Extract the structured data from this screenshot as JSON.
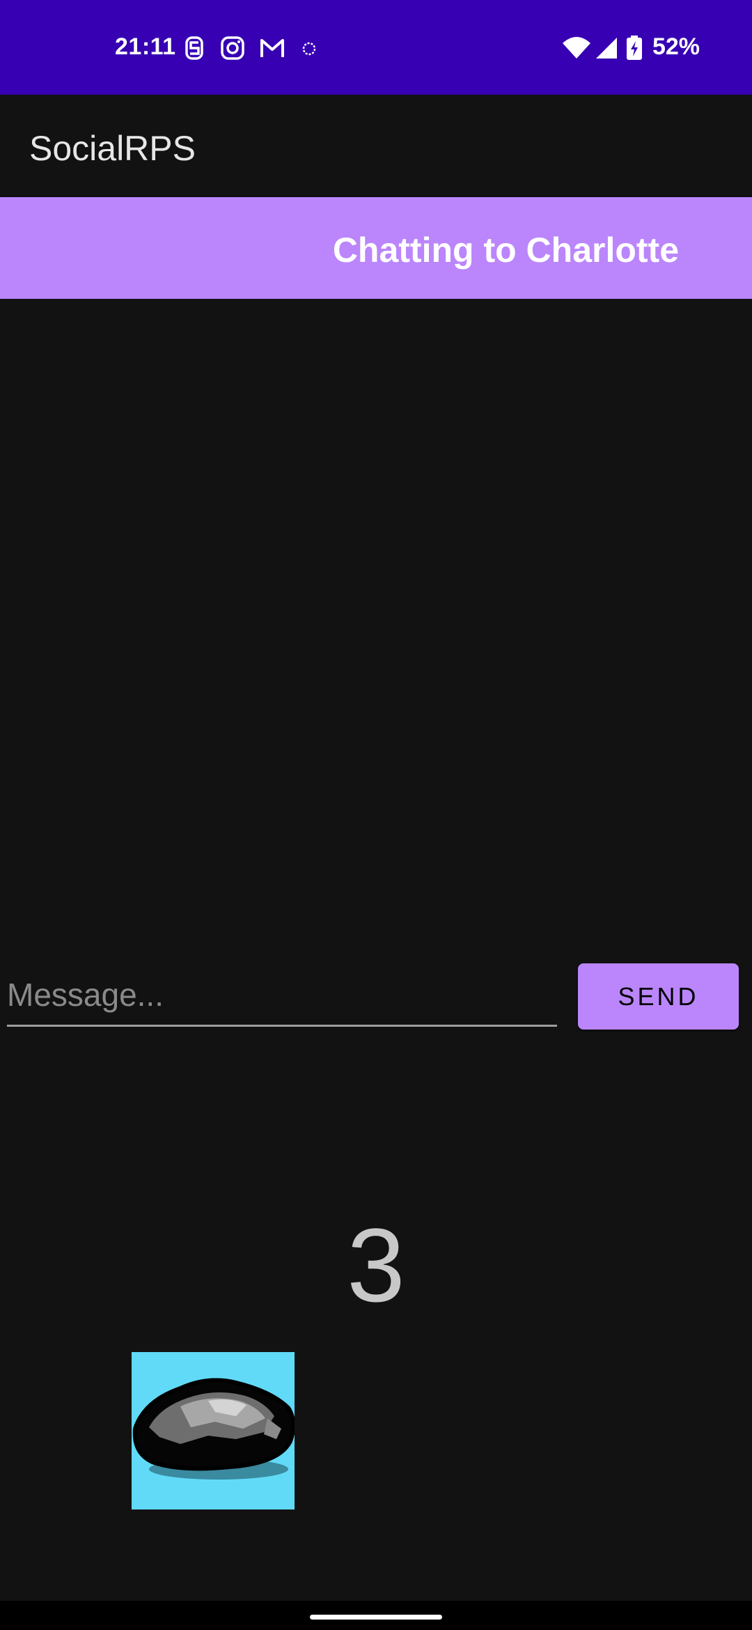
{
  "status_bar": {
    "time": "21:11",
    "battery": "52%",
    "background_color": "#3700B3",
    "icons": [
      "notification-s-icon",
      "instagram-icon",
      "gmail-icon",
      "status-dot-icon",
      "wifi-icon",
      "signal-icon",
      "battery-charging-icon"
    ]
  },
  "app_bar": {
    "title": "SocialRPS"
  },
  "chat_header": {
    "text": "Chatting to Charlotte",
    "background_color": "#BB86FC"
  },
  "message_input": {
    "value": "",
    "placeholder": "Message..."
  },
  "send_button": {
    "label": "SEND"
  },
  "game": {
    "countdown": "3",
    "selected_choice": "rock",
    "choice_icon": "rock-icon",
    "tile_color": "#61DAF7"
  }
}
